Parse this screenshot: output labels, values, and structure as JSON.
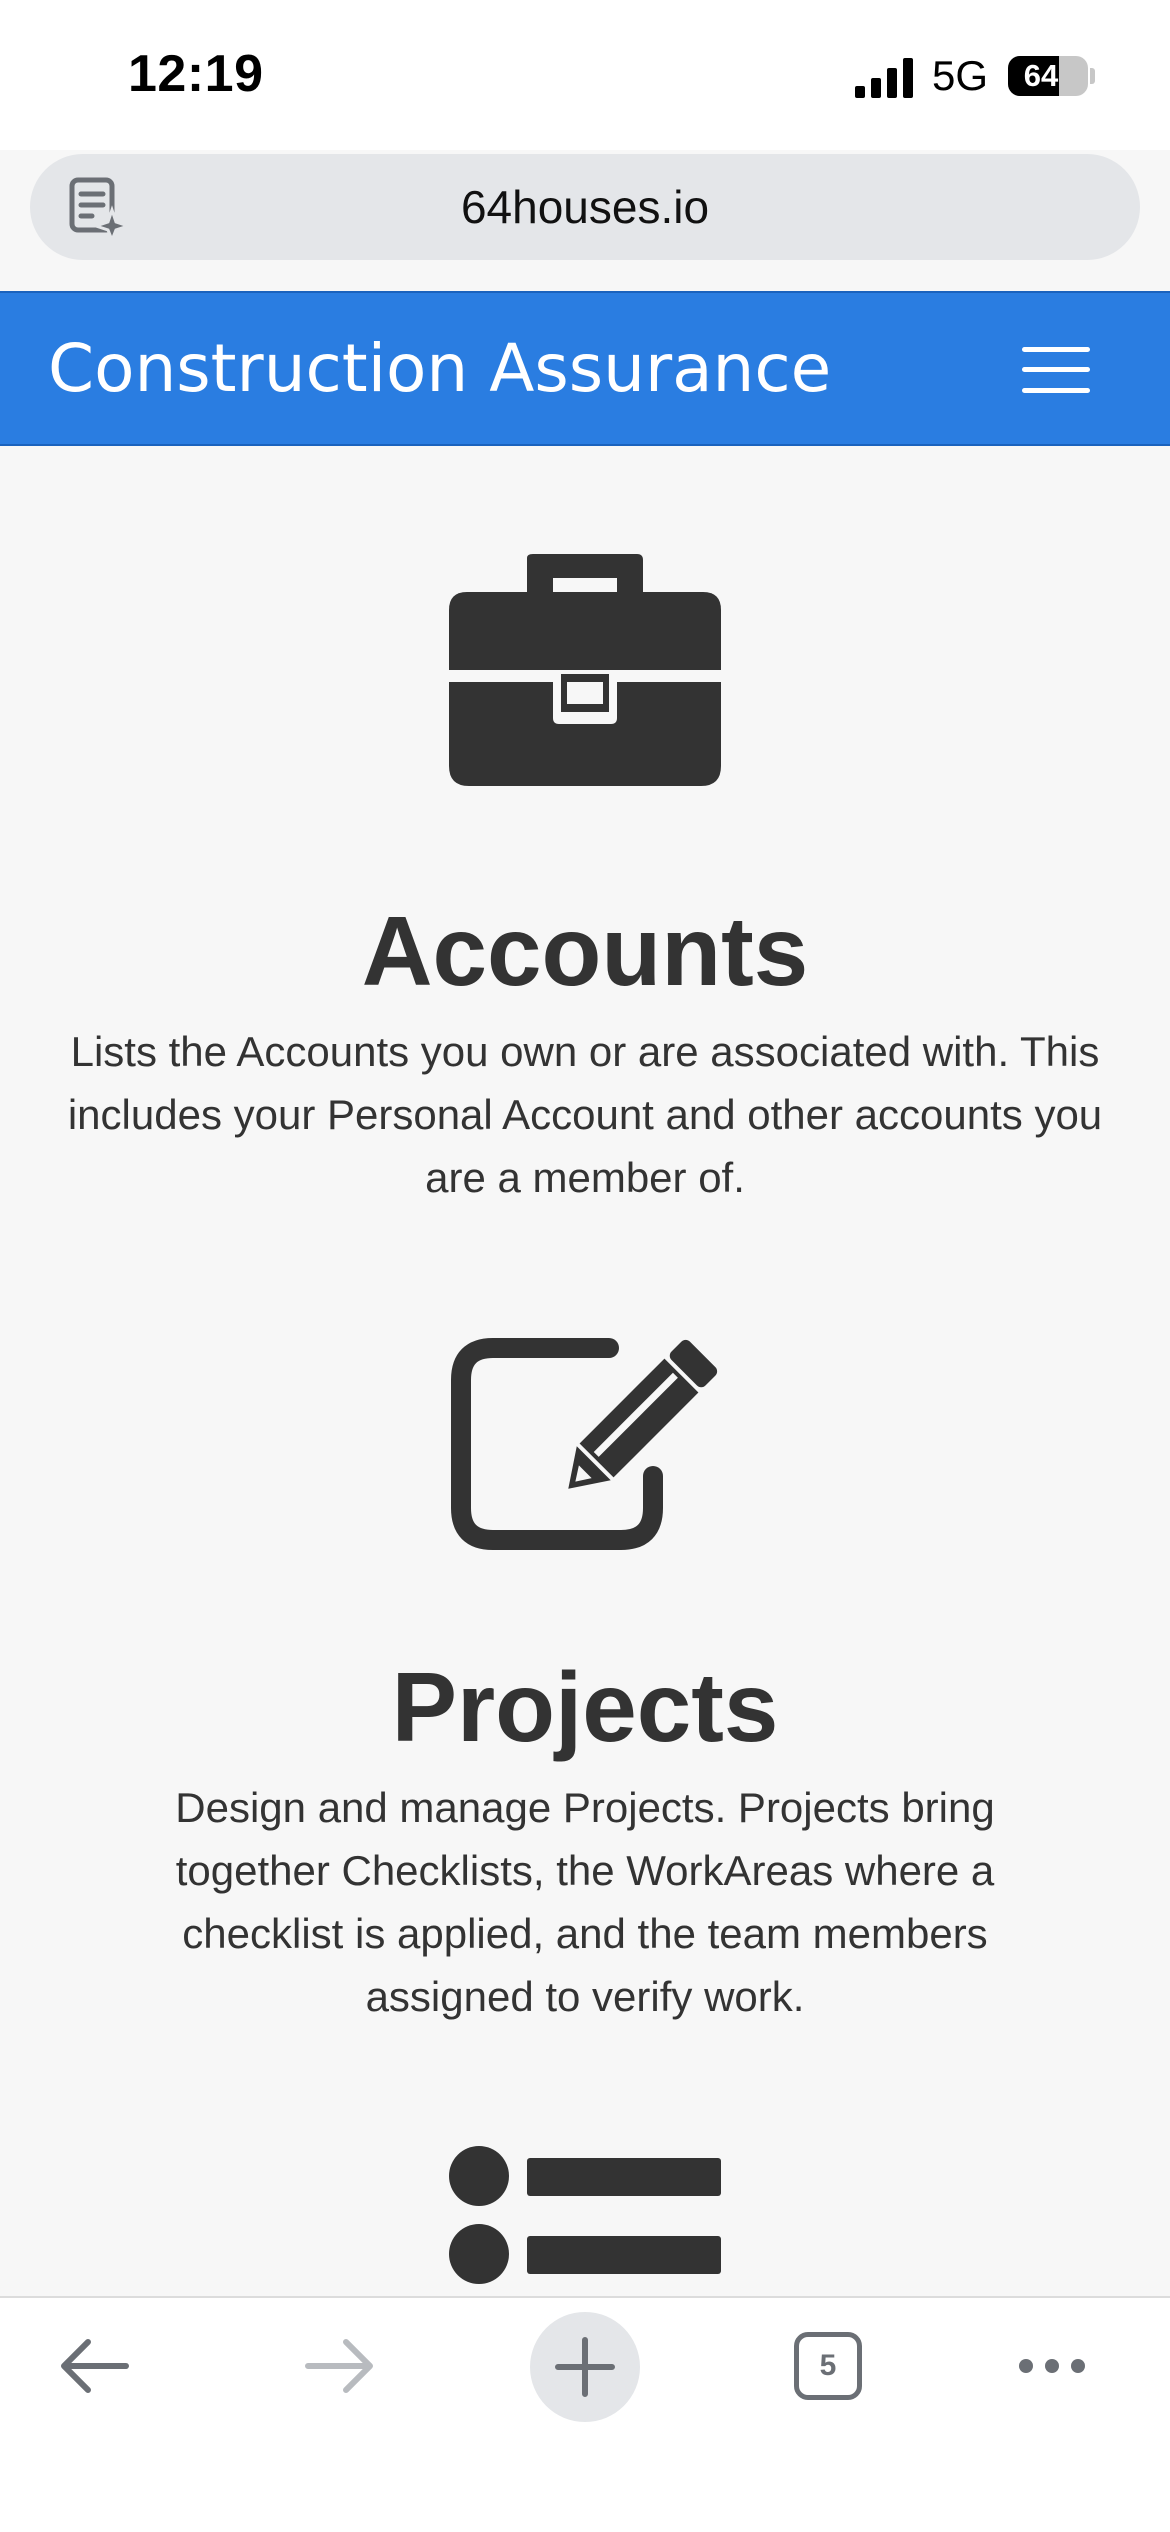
{
  "status_bar": {
    "time": "12:19",
    "network": "5G",
    "battery_level": "64",
    "battery_fraction": 0.64
  },
  "browser": {
    "url": "64houses.io",
    "tab_count": "5",
    "icons": {
      "page_info": "page-summary-icon",
      "back": "back-arrow-icon",
      "forward": "forward-arrow-icon",
      "new_tab": "plus-icon",
      "tabs": "tabs-icon",
      "more": "more-icon"
    }
  },
  "navbar": {
    "brand": "Construction Assurance",
    "menu_icon": "hamburger-icon",
    "background_color": "#2a7de1"
  },
  "features": [
    {
      "icon": "briefcase-icon",
      "title": "Accounts",
      "description": "Lists the Accounts you own or are associated with. This includes your Personal Account and other accounts you are a member of."
    },
    {
      "icon": "edit-square-icon",
      "title": "Projects",
      "description": "Design and manage Projects. Projects bring together Checklists, the WorkAreas where a checklist is applied, and the team members assigned to verify work."
    },
    {
      "icon": "list-icon"
    }
  ],
  "colors": {
    "text": "#333333",
    "page_background": "#f7f7f7",
    "toolbar_icon": "#6b6f75"
  }
}
